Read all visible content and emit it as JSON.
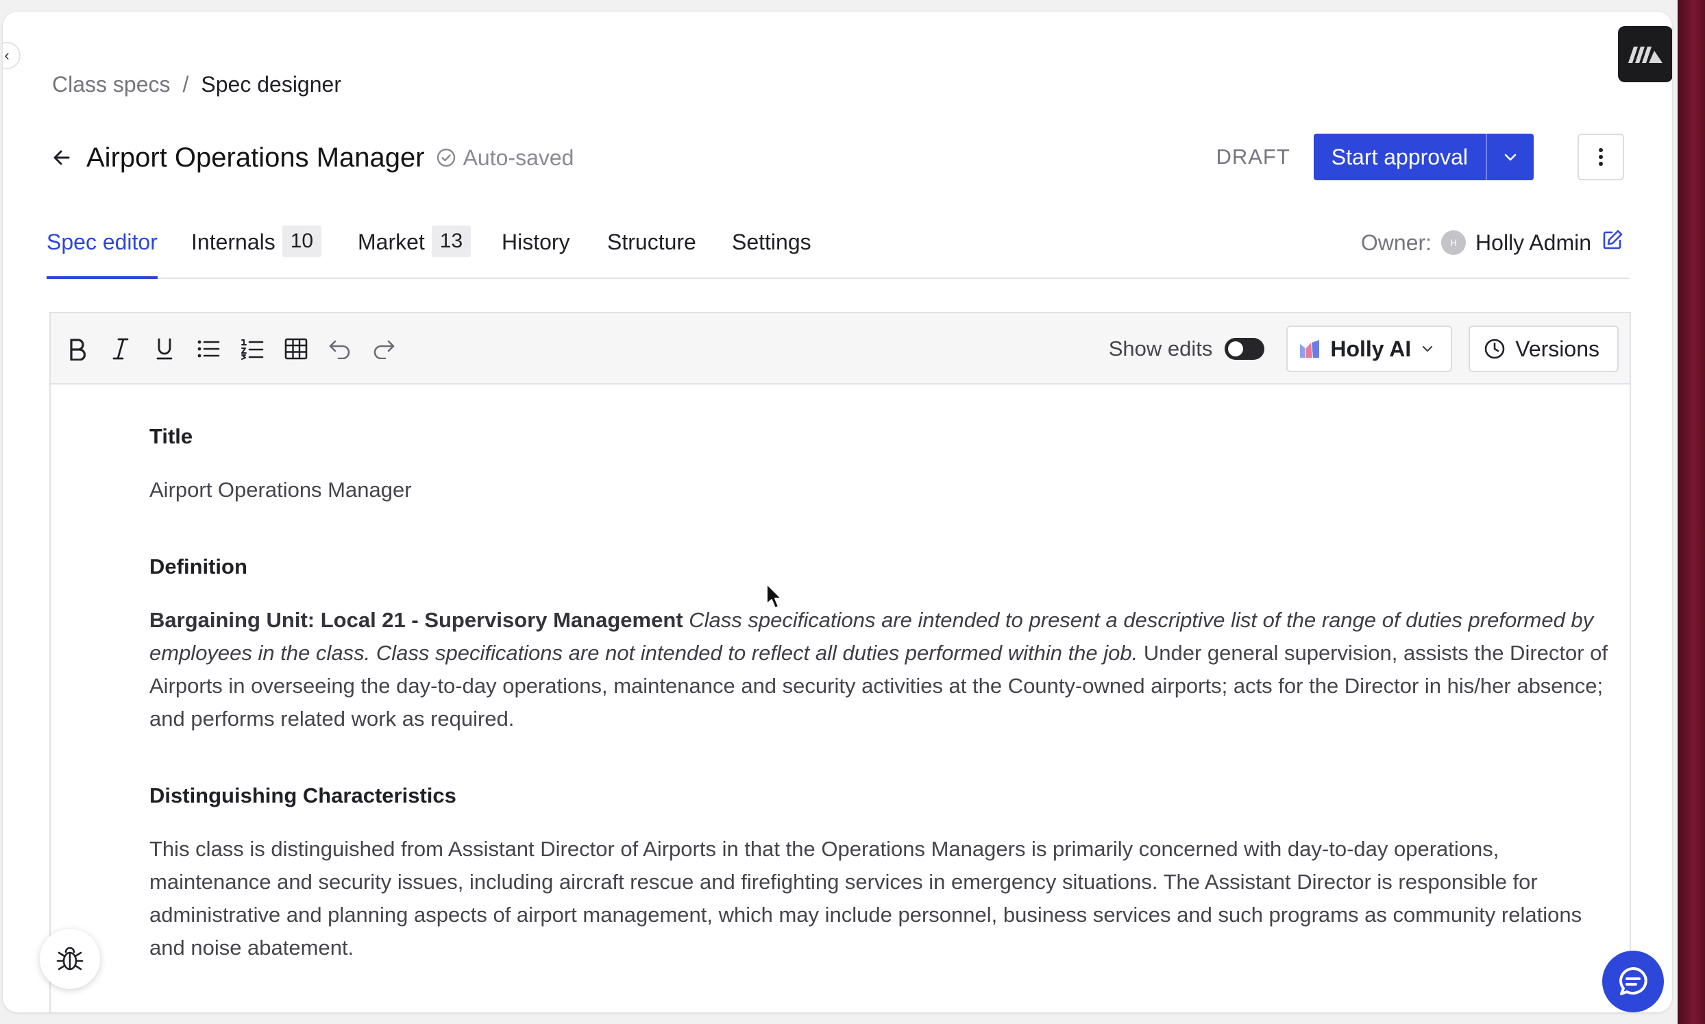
{
  "breadcrumb": {
    "parent": "Class specs",
    "separator": "/",
    "current": "Spec designer"
  },
  "header": {
    "title": "Airport Operations Manager",
    "autosave_text": "Auto-saved",
    "status": "DRAFT",
    "primary_action": "Start approval"
  },
  "tabs": [
    {
      "label": "Spec editor",
      "active": true
    },
    {
      "label": "Internals",
      "count": "10"
    },
    {
      "label": "Market",
      "count": "13"
    },
    {
      "label": "History"
    },
    {
      "label": "Structure"
    },
    {
      "label": "Settings"
    }
  ],
  "owner": {
    "label": "Owner:",
    "avatar_initial": "H",
    "name": "Holly Admin"
  },
  "toolbar": {
    "tools": [
      "bold-icon",
      "italic-icon",
      "underline-icon",
      "bullet-list-icon",
      "numbered-list-icon",
      "table-icon",
      "undo-icon",
      "redo-icon"
    ],
    "show_edits_label": "Show edits",
    "show_edits_on": false,
    "ai_label": "Holly AI",
    "versions_label": "Versions"
  },
  "document": {
    "title_heading": "Title",
    "title_value": "Airport Operations Manager",
    "definition_heading": "Definition",
    "definition_bold": "Bargaining Unit: Local 21 - Supervisory Management",
    "definition_italic": "Class specifications are intended to present a descriptive list of the range of duties preformed by employees in the class. Class specifications are not intended to reflect all duties performed within the job.",
    "definition_text": "Under general supervision, assists the Director of Airports in overseeing the day-to-day operations, maintenance and security activities at the County-owned airports; acts for the Director in his/her absence; and performs related work as required.",
    "distinguishing_heading": "Distinguishing Characteristics",
    "distinguishing_text": "This class is distinguished from Assistant Director of Airports in that the Operations Managers is primarily concerned with day-to-day operations, maintenance and security issues, including aircraft rescue and firefighting services in emergency situations. The Assistant Director is responsible for administrative and planning aspects of airport management, which may include personnel, business services and such programs as community relations and noise abatement."
  },
  "colors": {
    "accent": "#2c47d9",
    "edge": "#7a1731"
  }
}
